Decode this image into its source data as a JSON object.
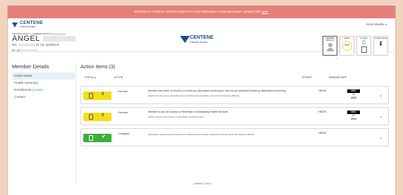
{
  "banner": {
    "text": "Welcome to Centene Clinical Action! For more information on known issues, please click ",
    "link": "here"
  },
  "header": {
    "brand": "CENTENE",
    "brand_sub": "Clinical Action",
    "user_name": "Kevin Mueller",
    "user_caret": "▾",
    "breadcrumb": "CENTENE HEALTH / MEMBER DETAILS",
    "member_first_name": "ANGEL",
    "member_dob_prefix": "Dec",
    "member_dob_suffix": "25 | M, undefined",
    "member_id_prefix": "ID: 10",
    "center_brand": "CENTENE",
    "center_brand_sub": "Clinical Action",
    "collapse_icon": "^"
  },
  "tiles": [
    {
      "label": "MEMBER DETAILS"
    },
    {
      "label": "HEDIS",
      "value": "33%"
    },
    {
      "label": "CLAIMS",
      "value": "0"
    },
    {
      "label": "COVER PAGE"
    }
  ],
  "sidebar": {
    "title": "Member Details",
    "items": [
      {
        "label": "Action Items"
      },
      {
        "label": "Health Summary"
      },
      {
        "label": "Enrollments",
        "extra": "(Active)"
      },
      {
        "label": "Contact"
      }
    ]
  },
  "main": {
    "title": "Action Items (3)",
    "columns": {
      "status": "STATUS ▲",
      "action": "ACTION",
      "source": "SOURCE",
      "deadline": "DEADLINE DATE"
    },
    "rows": [
      {
        "status": "Overdue",
        "badge_color": "#f3df17",
        "badge_mark": "0",
        "action": "Member has either no record of a follow-up depression screening or has not yet completed follow-up depression screening",
        "measure": "Depression Screening and Follow-Up for Adolescents and Adults: Depression Screening (DSF-E)",
        "source": "HEDIS",
        "month": "DEC",
        "day": "31",
        "year": "2024"
      },
      {
        "status": "Overdue",
        "badge_color": "#f3df17",
        "badge_mark": "0",
        "action": "Member is due for Access to Preventive or Ambulatory Health Services",
        "measure": "Adults' Access to Preventive or Ambulatory Health Services",
        "source": "HEDIS",
        "month": "DEC",
        "day": "31",
        "year": "2024"
      },
      {
        "status": "Compliant",
        "badge_color": "#3fae3b",
        "badge_mark": "✔",
        "action": "",
        "measure": "Depression Screening and Follow-Up for Adolescents and Adults: Depression Screening 30 day follow-up (DSF1)",
        "source": "HEDIS",
        "month": "",
        "day": "",
        "year": ""
      }
    ]
  },
  "footer": {
    "text": "Centene © 2024"
  }
}
